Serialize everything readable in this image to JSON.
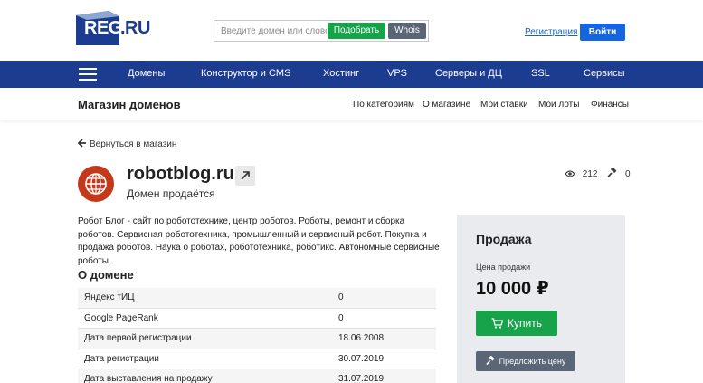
{
  "header": {
    "logo_text": "REG",
    "logo_suffix": ".RU",
    "search_placeholder": "Введите домен или слово",
    "pick_label": "Подобрать",
    "whois_label": "Whois",
    "register_link": "Регистрация",
    "login_label": "Войти"
  },
  "nav": {
    "items": [
      "Домены",
      "Конструктор и CMS",
      "Хостинг",
      "VPS",
      "Серверы и ДЦ",
      "SSL",
      "Сервисы"
    ]
  },
  "subnav": {
    "title": "Магазин доменов",
    "items": [
      "По категориям",
      "О магазине",
      "Мои ставки",
      "Мои лоты",
      "Финансы"
    ]
  },
  "back_label": "Вернуться в магазин",
  "domain": {
    "name": "robotblog.ru",
    "status": "Домен продаётся",
    "views": "212",
    "bids": "0",
    "description": "Робот Блог - сайт по робототехнике, центр роботов. Роботы, ремонт и сборка роботов. Сервисная робототехника, промышленный и сервисный робот. Покупка и продажа роботов. Наука о роботах, робототехника, роботикс. Автономные сервисные роботы."
  },
  "about": {
    "title": "О домене",
    "rows": [
      {
        "label": "Яндекс тИЦ",
        "value": "0"
      },
      {
        "label": "Google PageRank",
        "value": "0"
      },
      {
        "label": "Дата первой регистрации",
        "value": "18.06.2008"
      },
      {
        "label": "Дата регистрации",
        "value": "30.07.2019"
      },
      {
        "label": "Дата выставления на продажу",
        "value": "31.07.2019"
      }
    ]
  },
  "sale": {
    "title": "Продажа",
    "price_label": "Цена продажи",
    "price": "10 000 ₽",
    "buy_label": "Купить",
    "offer_label": "Предложить цену"
  },
  "colors": {
    "brand_blue": "#1c3d8f",
    "green": "#17a34a",
    "gray_button": "#5a6575",
    "globe_red": "#c4391b",
    "login_blue": "#1665e0"
  }
}
